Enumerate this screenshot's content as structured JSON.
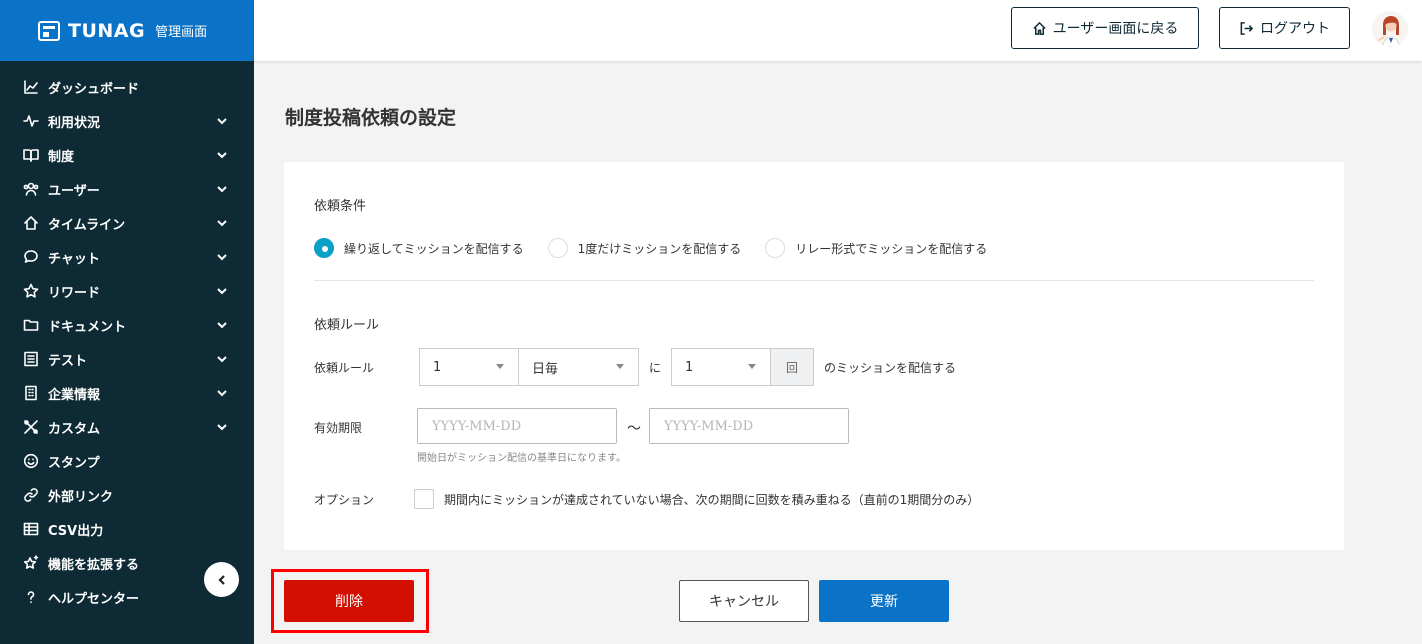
{
  "brand": {
    "name": "TUNAG",
    "subtitle": "管理画面"
  },
  "sidebar": {
    "items": [
      {
        "label": "ダッシュボード",
        "icon": "chart-line-icon",
        "expandable": false
      },
      {
        "label": "利用状況",
        "icon": "pulse-icon",
        "expandable": true
      },
      {
        "label": "制度",
        "icon": "book-icon",
        "expandable": true
      },
      {
        "label": "ユーザー",
        "icon": "users-icon",
        "expandable": true
      },
      {
        "label": "タイムライン",
        "icon": "home-icon",
        "expandable": true
      },
      {
        "label": "チャット",
        "icon": "chat-bubble-icon",
        "expandable": true
      },
      {
        "label": "リワード",
        "icon": "star-icon",
        "expandable": true
      },
      {
        "label": "ドキュメント",
        "icon": "folder-icon",
        "expandable": true
      },
      {
        "label": "テスト",
        "icon": "list-icon",
        "expandable": true
      },
      {
        "label": "企業情報",
        "icon": "building-icon",
        "expandable": true
      },
      {
        "label": "カスタム",
        "icon": "tools-icon",
        "expandable": true
      },
      {
        "label": "スタンプ",
        "icon": "smile-icon",
        "expandable": false
      },
      {
        "label": "外部リンク",
        "icon": "link-icon",
        "expandable": false
      },
      {
        "label": "CSV出力",
        "icon": "table-icon",
        "expandable": false
      },
      {
        "label": "機能を拡張する",
        "icon": "sparkle-star-icon",
        "expandable": false
      },
      {
        "label": "ヘルプセンター",
        "icon": "question-icon",
        "expandable": false
      }
    ]
  },
  "header": {
    "user_screen_label": "ユーザー画面に戻る",
    "logout_label": "ログアウト"
  },
  "page": {
    "title": "制度投稿依頼の設定"
  },
  "form": {
    "condition_title": "依頼条件",
    "radios": [
      {
        "label": "繰り返してミッションを配信する",
        "selected": true
      },
      {
        "label": "1度だけミッションを配信する",
        "selected": false
      },
      {
        "label": "リレー形式でミッションを配信する",
        "selected": false
      }
    ],
    "rule_section_title": "依頼ルール",
    "rule_label": "依頼ルール",
    "rule_interval_value": "1",
    "rule_period_value": "日毎",
    "rule_ni": "に",
    "rule_count_value": "1",
    "rule_count_unit": "回",
    "rule_suffix": "のミッションを配信する",
    "validity_label": "有効期限",
    "date_placeholder": "YYYY-MM-DD",
    "date_separator": "～",
    "validity_hint": "開始日がミッション配信の基準日になります。",
    "option_label": "オプション",
    "option_text": "期間内にミッションが達成されていない場合、次の期間に回数を積み重ねる（直前の1期間分のみ）"
  },
  "footer": {
    "delete_label": "削除",
    "cancel_label": "キャンセル",
    "update_label": "更新"
  },
  "colors": {
    "sidebar_bg": "#0e2a35",
    "brand_bg": "#0b73c7",
    "primary": "#0b73c7",
    "danger": "#d20f00",
    "radio_active": "#0aa0c8",
    "highlight": "#ff0000"
  }
}
